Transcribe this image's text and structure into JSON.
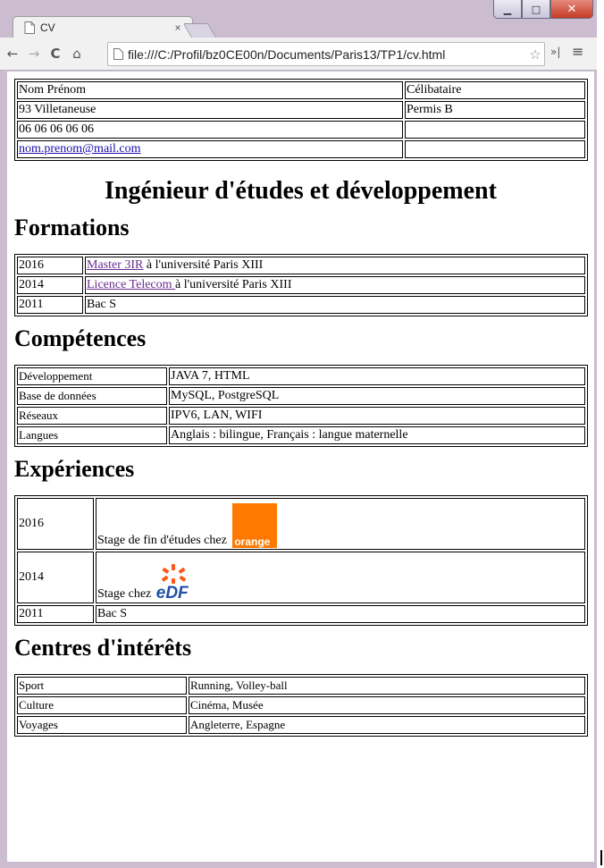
{
  "browser": {
    "tab_title": "CV",
    "tab_close": "×",
    "url": "file:///C:/Profil/bz0CE00n/Documents/Paris13/TP1/cv.html"
  },
  "colors": {
    "accent_link": "#1a0dab",
    "visited_link": "#6a2a8f",
    "orange_brand": "#ff7900",
    "edf_blue": "#1f4fa6",
    "edf_orange": "#fe5815"
  },
  "icons": [
    "page-icon",
    "back-icon",
    "forward-icon",
    "reload-icon",
    "home-icon",
    "star-icon",
    "extensions-icon",
    "menu-icon",
    "minimize-icon",
    "maximize-icon",
    "close-icon"
  ],
  "contact": {
    "rows": [
      {
        "left": "Nom Prénom",
        "right": "Célibataire"
      },
      {
        "left": "93 Villetaneuse",
        "right": "Permis B"
      },
      {
        "left": "06 06 06 06 06",
        "right": ""
      },
      {
        "left": "nom.prenom@mail.com",
        "right": ""
      }
    ]
  },
  "title": "Ingénieur d'études et développement",
  "formations": {
    "heading": "Formations",
    "rows": [
      {
        "year": "2016",
        "link": "Master 3IR",
        "rest": " à l'université Paris XIII"
      },
      {
        "year": "2014",
        "link": "Licence Telecom ",
        "rest": "à l'université Paris XIII"
      },
      {
        "year": "2011",
        "link": "",
        "rest": "Bac S"
      }
    ]
  },
  "competences": {
    "heading": "Compétences",
    "rows": [
      {
        "label": "Développement",
        "value": "JAVA 7, HTML"
      },
      {
        "label": "Base de données",
        "value": "MySQL, PostgreSQL"
      },
      {
        "label": "Réseaux",
        "value": "IPV6, LAN, WIFI"
      },
      {
        "label": "Langues",
        "value": "Anglais : bilingue, Français : langue maternelle"
      }
    ]
  },
  "experiences": {
    "heading": "Expériences",
    "rows": [
      {
        "year": "2016",
        "text": "Stage de fin d'études chez ",
        "logo": "orange"
      },
      {
        "year": "2014",
        "text": "Stage chez ",
        "logo": "edf"
      },
      {
        "year": "2011",
        "text": "Bac S",
        "logo": ""
      }
    ],
    "orange_logo_text": "orange",
    "edf_logo_text": "eDF"
  },
  "centres": {
    "heading": "Centres d'intérêts",
    "rows": [
      {
        "label": "Sport",
        "value": "Running, Volley-ball"
      },
      {
        "label": "Culture",
        "value": "Cinéma, Musée"
      },
      {
        "label": "Voyages",
        "value": "Angleterre, Espagne"
      }
    ]
  }
}
